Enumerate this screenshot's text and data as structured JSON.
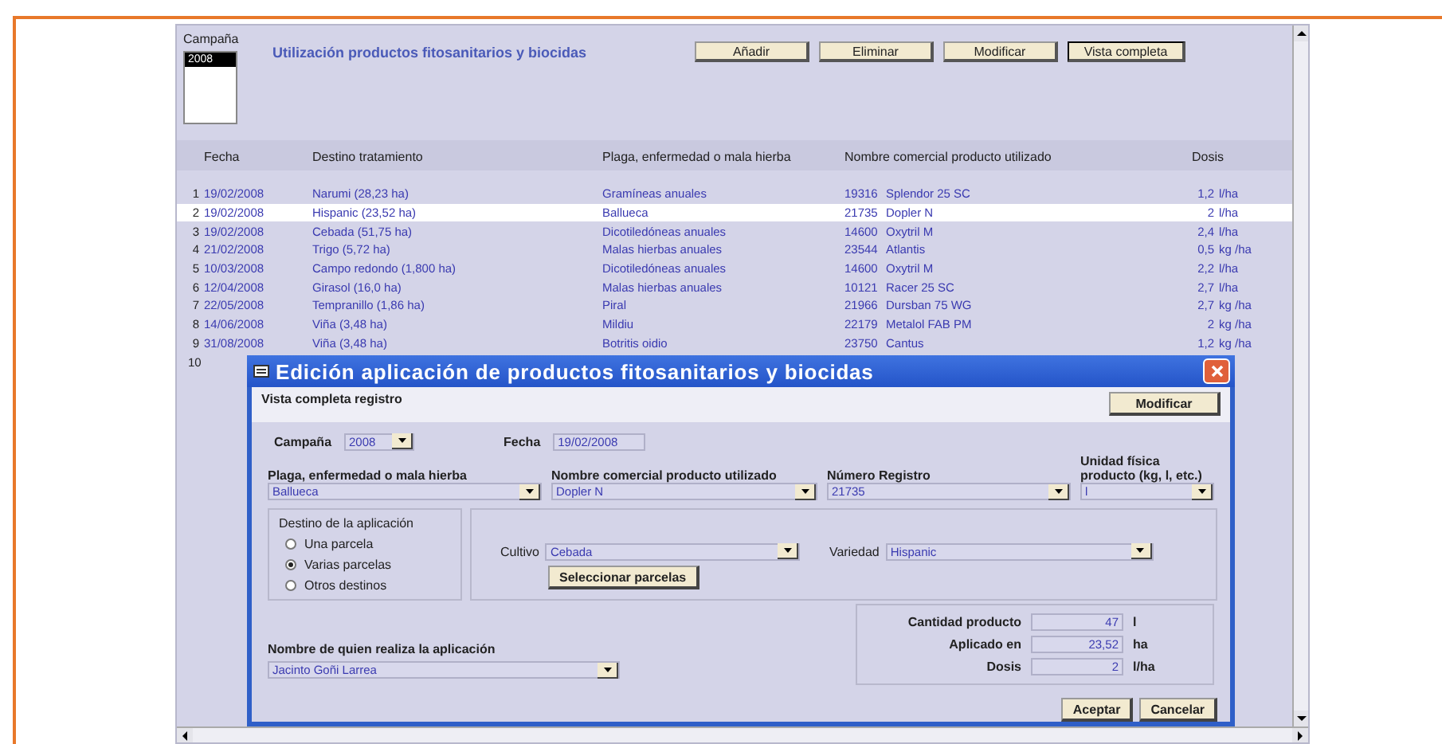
{
  "campaign_list": {
    "label": "Campaña",
    "items": [
      {
        "text": "2008",
        "selected": true
      }
    ]
  },
  "title": "Utilización productos fitosanitarios y biocidas",
  "toolbar": [
    {
      "label": "Añadir",
      "selected": false
    },
    {
      "label": "Eliminar",
      "selected": false
    },
    {
      "label": "Modificar",
      "selected": false
    },
    {
      "label": "Vista completa",
      "selected": true
    }
  ],
  "table": {
    "columns": [
      "Fecha",
      "Destino tratamiento",
      "Plaga, enfermedad o mala hierba",
      "Nombre comercial producto utilizado",
      "Dosis"
    ],
    "rows": [
      {
        "num": "1",
        "fecha": "19/02/2008",
        "destino": "Narumi (28,23 ha)",
        "plaga": "Gramíneas anuales",
        "registro": "19316",
        "producto": "Splendor 25 SC",
        "dosis": "1,2",
        "unidad": "l/ha",
        "selected": false
      },
      {
        "num": "2",
        "fecha": "19/02/2008",
        "destino": "Hispanic (23,52 ha)",
        "plaga": "Ballueca",
        "registro": "21735",
        "producto": "Dopler N",
        "dosis": "2",
        "unidad": "l/ha",
        "selected": true
      },
      {
        "num": "3",
        "fecha": "19/02/2008",
        "destino": "Cebada (51,75 ha)",
        "plaga": "Dicotiledóneas anuales",
        "registro": "14600",
        "producto": "Oxytril M",
        "dosis": "2,4",
        "unidad": "l/ha",
        "selected": false
      },
      {
        "num": "4",
        "fecha": "21/02/2008",
        "destino": "Trigo (5,72 ha)",
        "plaga": "Malas hierbas anuales",
        "registro": "23544",
        "producto": "Atlantis",
        "dosis": "0,5",
        "unidad": "kg /ha",
        "selected": false
      },
      {
        "num": "5",
        "fecha": "10/03/2008",
        "destino": "Campo redondo (1,800 ha)",
        "plaga": "Dicotiledóneas anuales",
        "registro": "14600",
        "producto": "Oxytril M",
        "dosis": "2,2",
        "unidad": "l/ha",
        "selected": false
      },
      {
        "num": "6",
        "fecha": "12/04/2008",
        "destino": "Girasol (16,0 ha)",
        "plaga": "Malas hierbas anuales",
        "registro": "10121",
        "producto": "Racer 25 SC",
        "dosis": "2,7",
        "unidad": "l/ha",
        "selected": false
      },
      {
        "num": "7",
        "fecha": "22/05/2008",
        "destino": "Tempranillo (1,86 ha)",
        "plaga": "Piral",
        "registro": "21966",
        "producto": "Dursban 75 WG",
        "dosis": "2,7",
        "unidad": "kg /ha",
        "selected": false
      },
      {
        "num": "8",
        "fecha": "14/06/2008",
        "destino": "Viña (3,48 ha)",
        "plaga": "Mildiu",
        "registro": "22179",
        "producto": "Metalol FAB PM",
        "dosis": "2",
        "unidad": "kg /ha",
        "selected": false
      },
      {
        "num": "9",
        "fecha": "31/08/2008",
        "destino": "Viña (3,48 ha)",
        "plaga": "Botritis oidio",
        "registro": "23750",
        "producto": "Cantus",
        "dosis": "1,2",
        "unidad": "kg /ha",
        "selected": false
      },
      {
        "num": "10",
        "selected": false
      }
    ]
  },
  "dialog": {
    "title": "Edición aplicación de productos fitosanitarios y biocidas",
    "subtitle": "Vista completa registro",
    "modify_button": "Modificar",
    "campaign": {
      "label": "Campaña",
      "value": "2008"
    },
    "date": {
      "label": "Fecha",
      "value": "19/02/2008"
    },
    "combos": [
      {
        "label": "Plaga, enfermedad o mala hierba",
        "value": "Ballueca"
      },
      {
        "label": "Nombre comercial producto utilizado",
        "value": "Dopler N"
      },
      {
        "label": "Número Registro",
        "value": "21735"
      },
      {
        "label": "Unidad física producto (kg, l, etc.)",
        "value": "l"
      }
    ],
    "destination": {
      "label": "Destino de la aplicación",
      "options": [
        {
          "label": "Una parcela",
          "selected": false
        },
        {
          "label": "Varias parcelas",
          "selected": true
        },
        {
          "label": "Otros destinos",
          "selected": false
        }
      ]
    },
    "crop": {
      "label": "Cultivo",
      "value": "Cebada"
    },
    "variety": {
      "label": "Variedad",
      "value": "Hispanic"
    },
    "select_plots_button": "Seleccionar parcelas",
    "applicator": {
      "label": "Nombre de quien realiza la aplicación",
      "value": "Jacinto Goñi Larrea"
    },
    "amounts": [
      {
        "label": "Cantidad producto",
        "value": "47",
        "unit": "l"
      },
      {
        "label": "Aplicado en",
        "value": "23,52",
        "unit": "ha"
      },
      {
        "label": "Dosis",
        "value": "2",
        "unit": "l/ha"
      }
    ],
    "buttons": [
      "Aceptar",
      "Cancelar"
    ]
  }
}
